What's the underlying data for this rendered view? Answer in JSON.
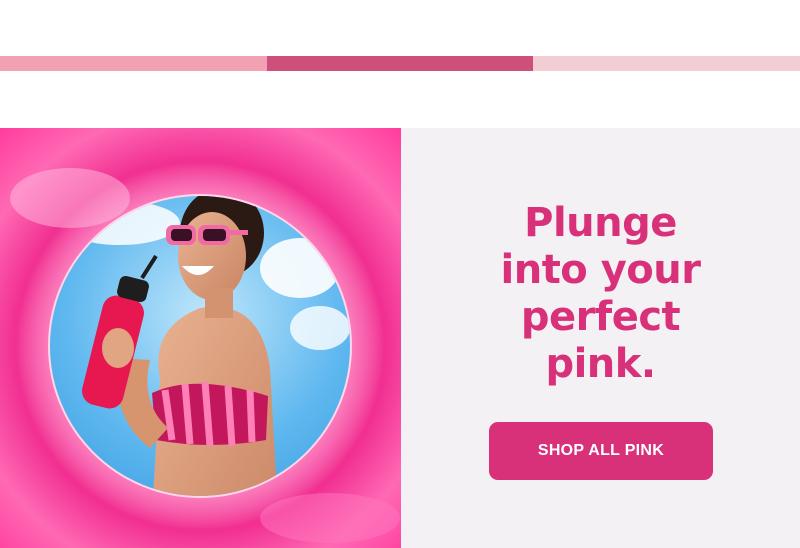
{
  "color_strip": {
    "colors": [
      "#f2a0b4",
      "#cf4f7c",
      "#f1cdd4"
    ]
  },
  "hero": {
    "image_alt": "Woman in pink sunglasses and striped pink bikini drinking from a pink water bottle, framed by a pink inflatable ring",
    "headline": "Plunge\ninto your\nperfect\npink.",
    "cta_label": "SHOP ALL PINK",
    "accent_color": "#d9307a",
    "panel_background": "#f3f1f3"
  }
}
